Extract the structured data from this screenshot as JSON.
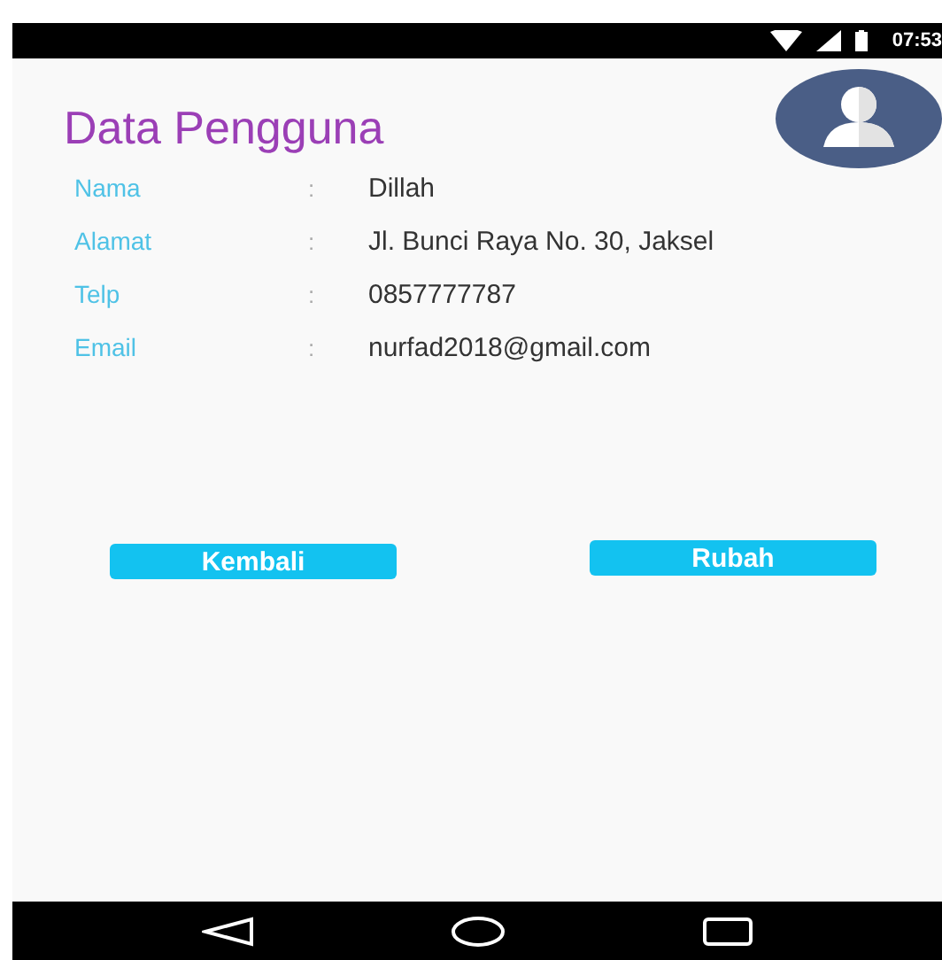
{
  "status_bar": {
    "time": "07:53"
  },
  "title": "Data Pengguna",
  "fields": [
    {
      "label": "Nama",
      "separator": ":",
      "value": "Dillah"
    },
    {
      "label": "Alamat",
      "separator": ":",
      "value": "Jl. Bunci Raya No. 30, Jaksel"
    },
    {
      "label": "Telp",
      "separator": ":",
      "value": "0857777787"
    },
    {
      "label": "Email",
      "separator": ":",
      "value": "nurfad2018@gmail.com"
    }
  ],
  "buttons": [
    "Kembali",
    "Rubah"
  ]
}
